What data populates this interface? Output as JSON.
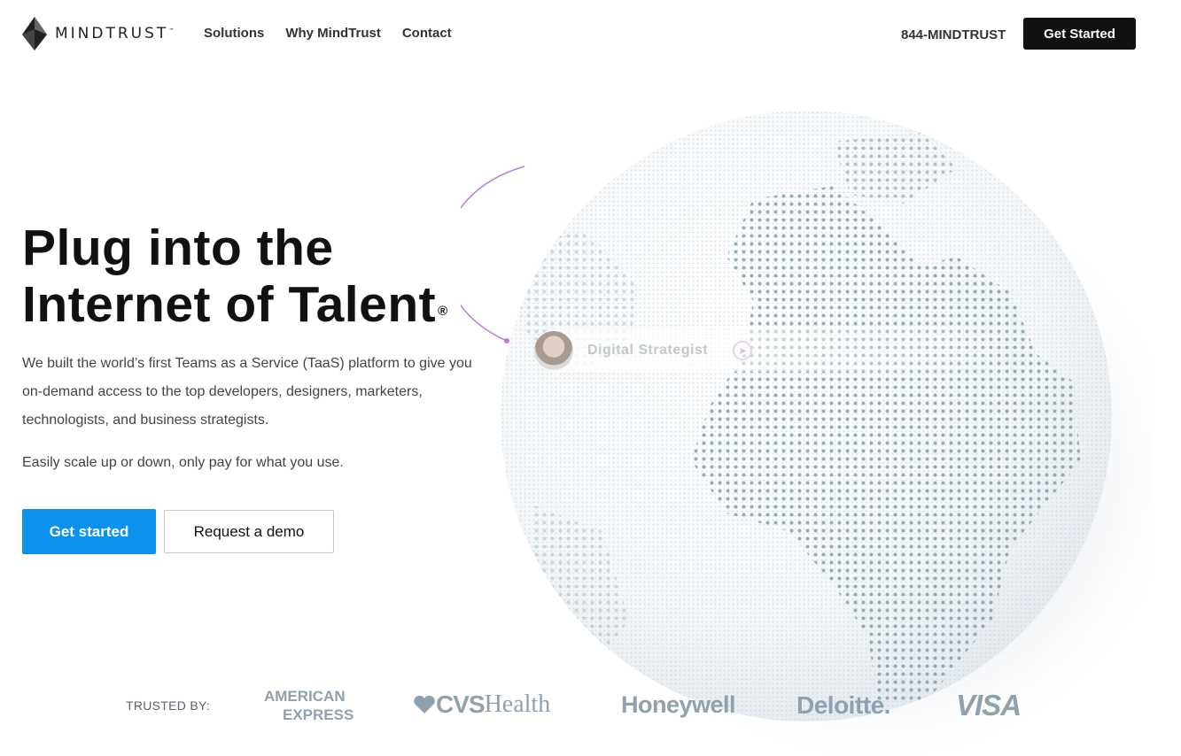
{
  "header": {
    "logo_text": "MINDTRUST",
    "nav": [
      "Solutions",
      "Why MindTrust",
      "Contact"
    ],
    "phone": "844-MINDTRUST",
    "cta_label": "Get Started"
  },
  "hero": {
    "headline_line1": "Plug into the",
    "headline_line2": "Internet of Talent",
    "headline_mark": "®",
    "paragraph1": "We built the world’s first Teams as a Service (TaaS) platform to give you on-demand access to the top developers, designers, marketers, technologists, and business strategists.",
    "paragraph2": "Easily scale up or down, only pay for what you use.",
    "primary_button": "Get started",
    "secondary_button": "Request a demo"
  },
  "globe": {
    "talent_card_label": "Digital Strategist",
    "icons": [
      "avatar",
      "compass-icon"
    ]
  },
  "trusted": {
    "label": "TRUSTED BY:",
    "brands": {
      "amex_line1": "AMERICAN",
      "amex_line2": "EXPRESS",
      "cvs_main": "CVS",
      "cvs_sub": "Health",
      "honeywell": "Honeywell",
      "deloitte": "Deloitte.",
      "visa": "VISA"
    }
  },
  "colors": {
    "primary": "#0a92ee",
    "dark": "#111111",
    "brand_gray": "#8fa0ae",
    "accent_purple": "#b77ce0"
  }
}
